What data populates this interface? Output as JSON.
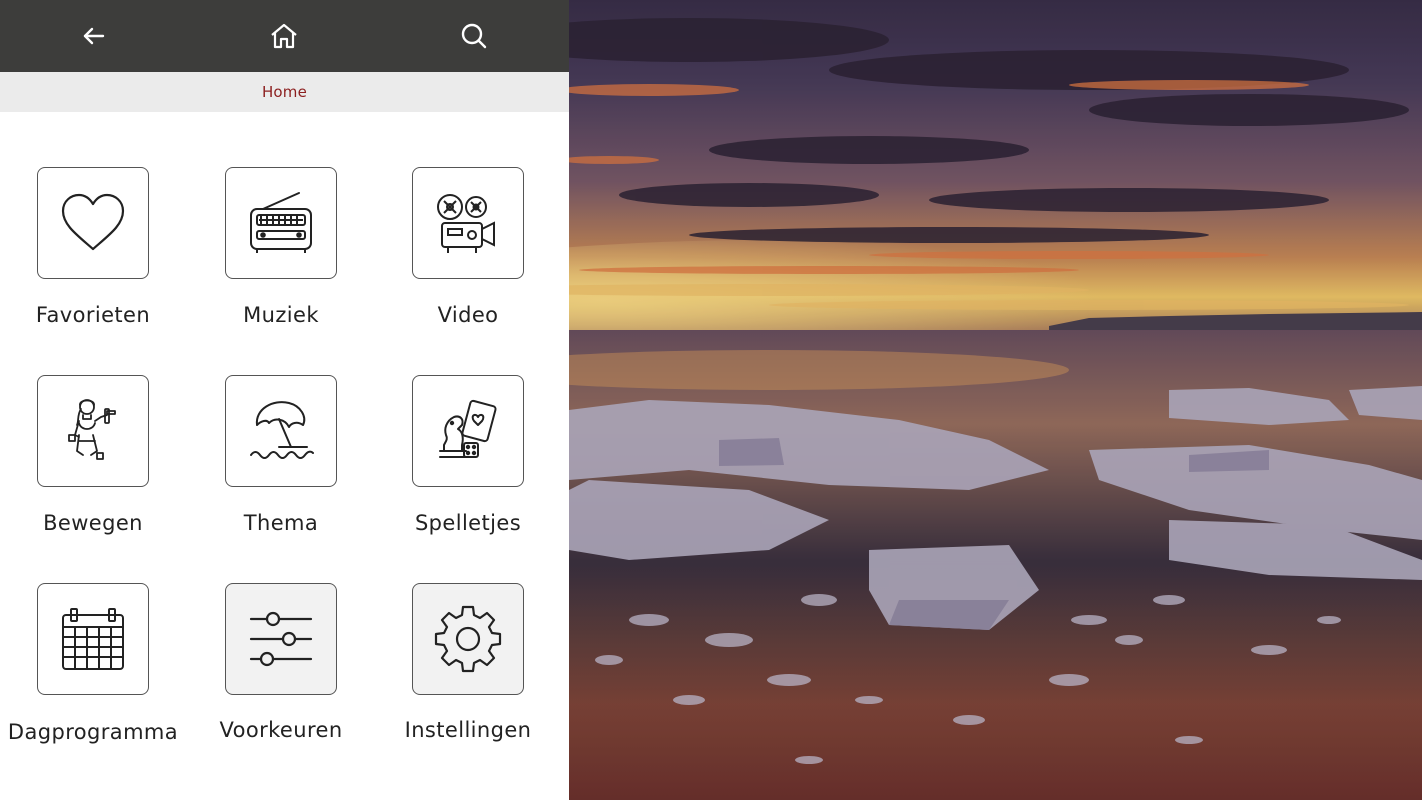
{
  "topbar": {
    "back_icon": "arrow-left-icon",
    "home_icon": "home-icon",
    "search_icon": "search-icon",
    "background_color": "#3d3d3b"
  },
  "breadcrumb": {
    "label": "Home",
    "color": "#8c1f1f"
  },
  "tiles": [
    {
      "label": "Favorieten",
      "icon": "heart-icon"
    },
    {
      "label": "Muziek",
      "icon": "radio-icon"
    },
    {
      "label": "Video",
      "icon": "film-projector-icon"
    },
    {
      "label": "Bewegen",
      "icon": "woman-exercising-icon"
    },
    {
      "label": "Thema",
      "icon": "beach-umbrella-icon"
    },
    {
      "label": "Spelletjes",
      "icon": "games-chess-cards-icon"
    },
    {
      "label": "Dagprogramma",
      "icon": "calendar-icon"
    },
    {
      "label": "Voorkeuren",
      "icon": "sliders-icon"
    },
    {
      "label": "Instellingen",
      "icon": "gear-icon"
    }
  ],
  "media": {
    "description_icon": "video-frame",
    "scene": "sunset-over-ice-floes"
  }
}
